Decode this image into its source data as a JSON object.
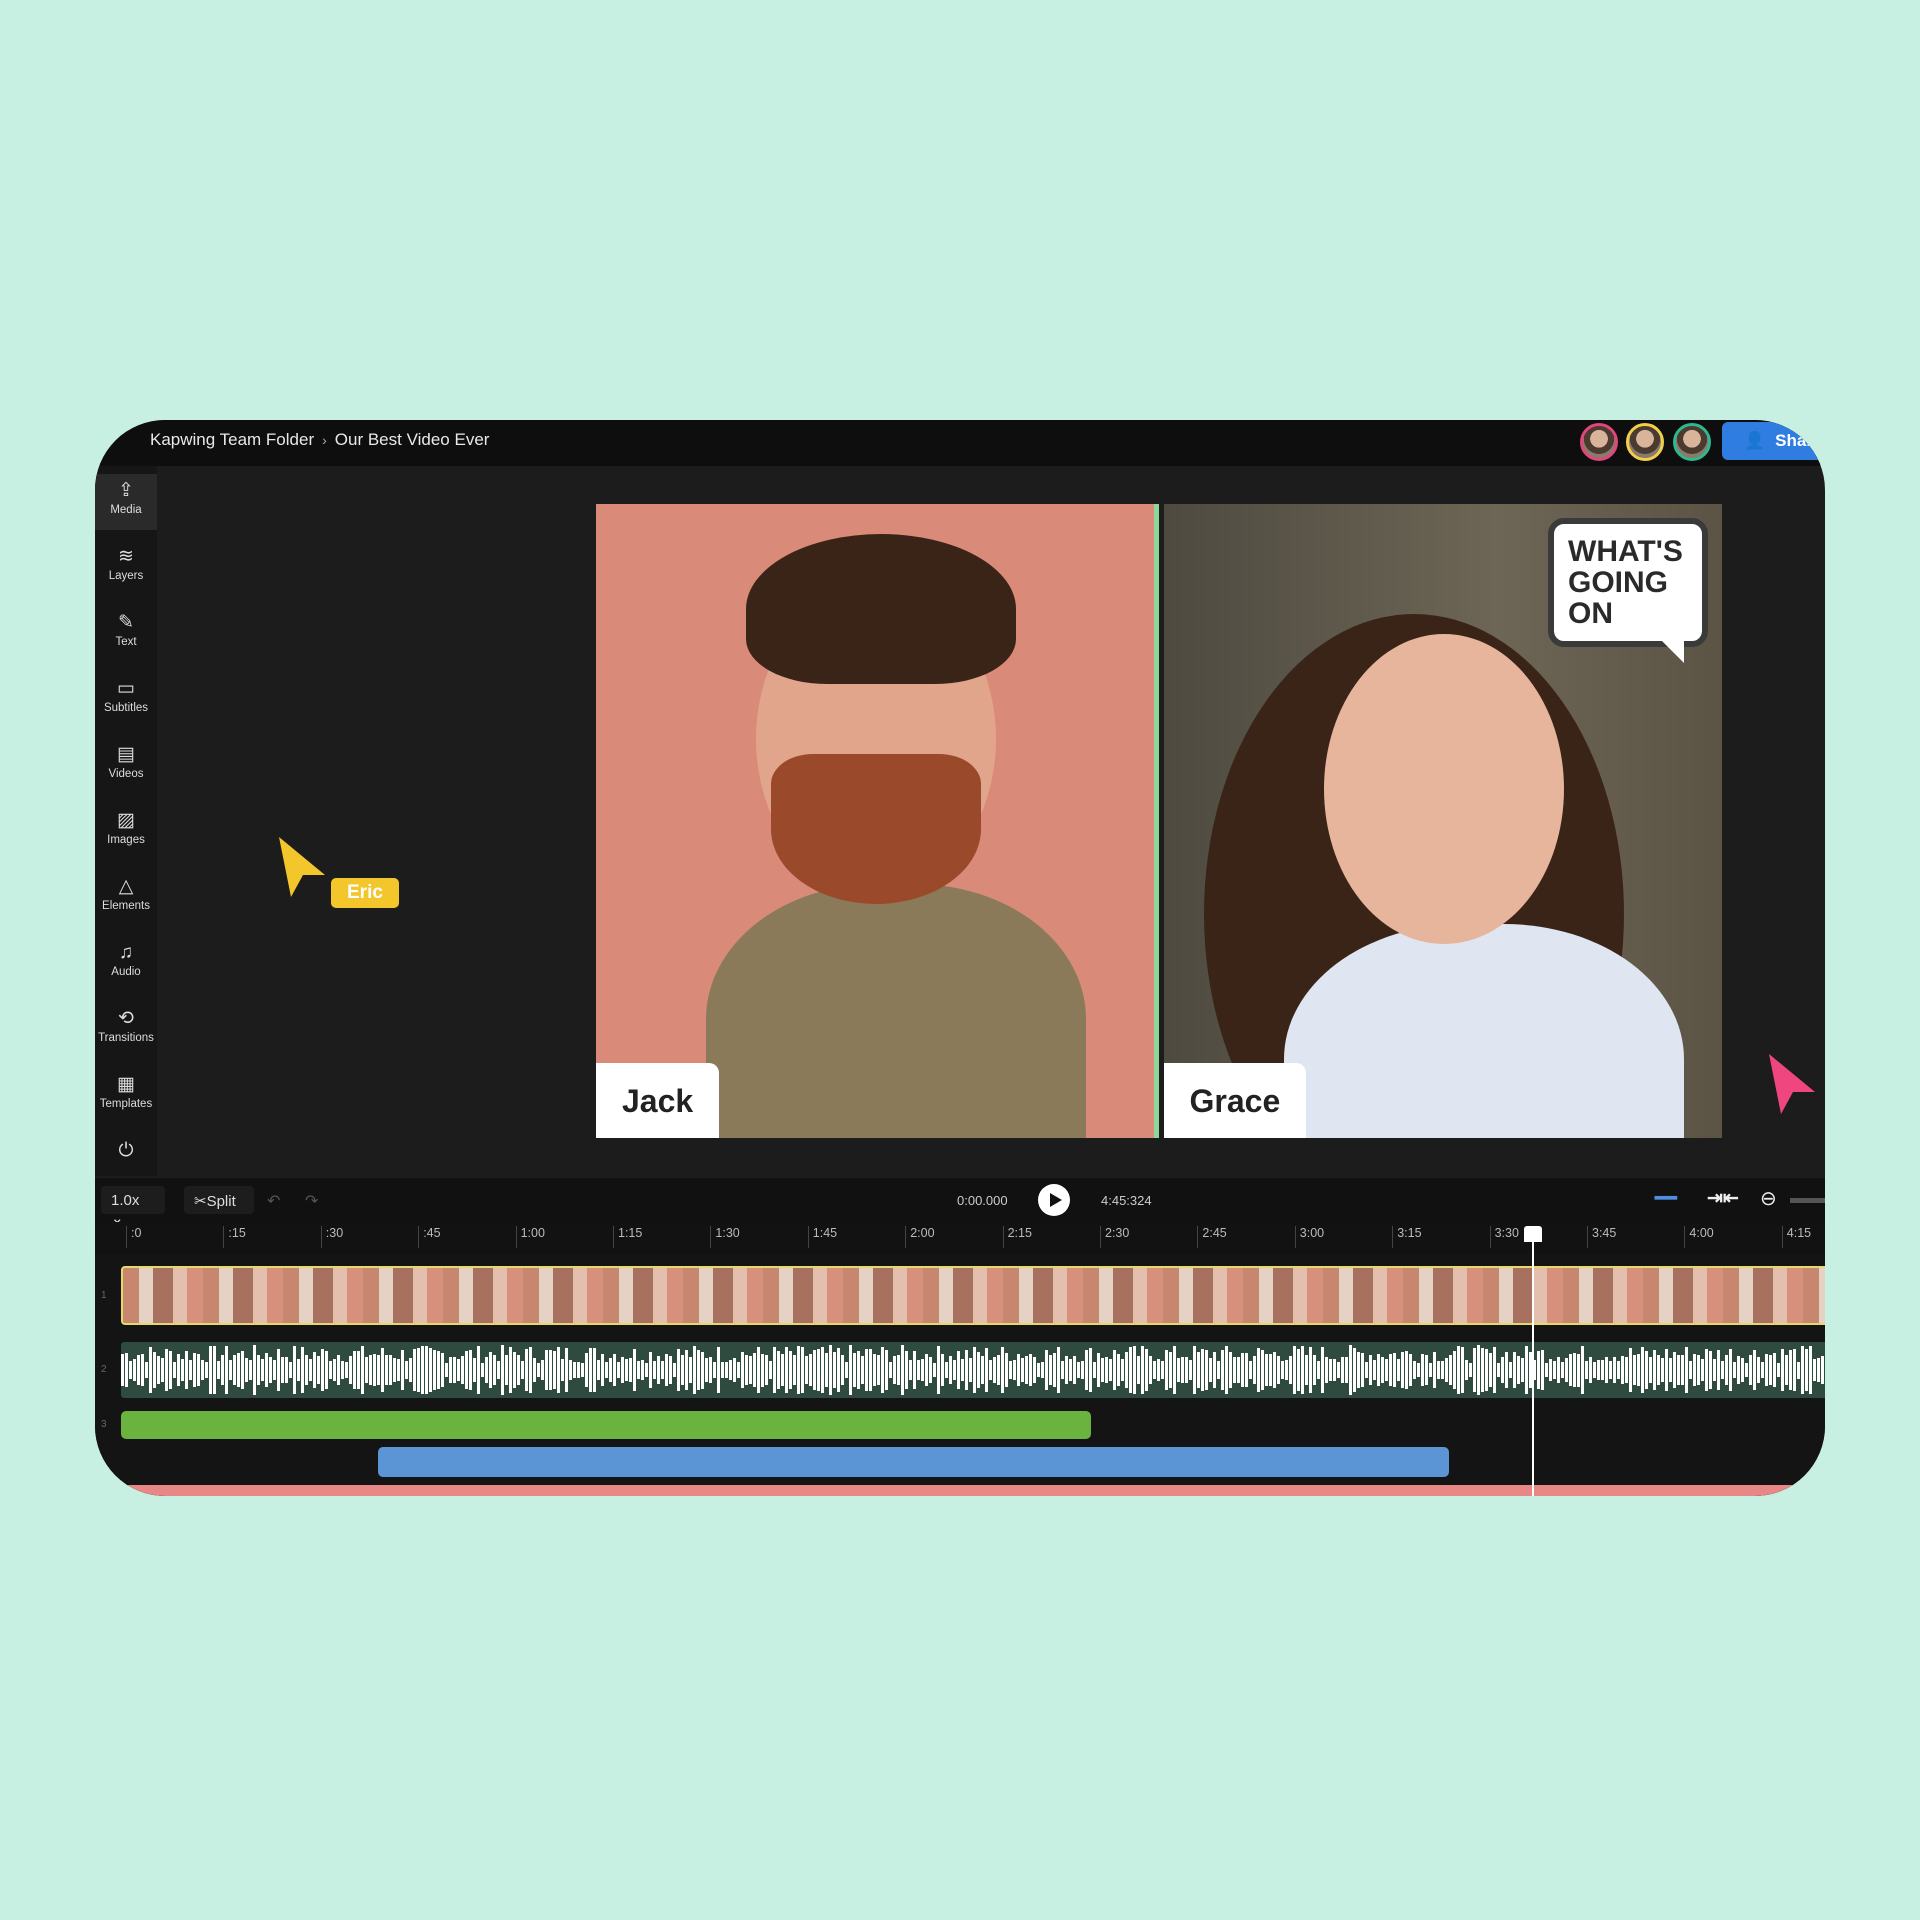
{
  "breadcrumb": {
    "folder": "Kapwing Team Folder",
    "separator": "›",
    "project": "Our Best Video Ever"
  },
  "collaborators": [
    {
      "color": "#e0457b"
    },
    {
      "color": "#f2cf4a"
    },
    {
      "color": "#2fb890"
    }
  ],
  "share_button": {
    "label": "Share",
    "icon": "add-user-icon"
  },
  "sidebar": {
    "items": [
      {
        "label": "Media",
        "icon": "⇪",
        "active": true
      },
      {
        "label": "Layers",
        "icon": "≋"
      },
      {
        "label": "Text",
        "icon": "✎"
      },
      {
        "label": "Subtitles",
        "icon": "▭"
      },
      {
        "label": "Videos",
        "icon": "▤"
      },
      {
        "label": "Images",
        "icon": "▨"
      },
      {
        "label": "Elements",
        "icon": "△"
      },
      {
        "label": "Audio",
        "icon": "♫"
      },
      {
        "label": "Transitions",
        "icon": "⟲"
      },
      {
        "label": "Templates",
        "icon": "▦"
      },
      {
        "label": "",
        "icon": "⏻"
      }
    ]
  },
  "canvas": {
    "left_name": "Jack",
    "right_name": "Grace",
    "bubble_lines": [
      "WHAT'S",
      "GOING",
      "ON"
    ]
  },
  "cursors": {
    "eric": {
      "label": "Eric",
      "color": "#f3c62b"
    },
    "other": {
      "color": "#f0467f"
    }
  },
  "timeline": {
    "speed": "1.0x",
    "split_label": "Split",
    "current_time": "0:00.000",
    "duration": "4:45:324",
    "ticks": [
      ":0",
      ":15",
      ":30",
      ":45",
      "1:00",
      "1:15",
      "1:30",
      "1:45",
      "2:00",
      "2:15",
      "2:30",
      "2:45",
      "3:00",
      "3:15",
      "3:30",
      "3:45",
      "4:00",
      "4:15"
    ],
    "track_numbers": [
      "1",
      "2",
      "3"
    ]
  }
}
